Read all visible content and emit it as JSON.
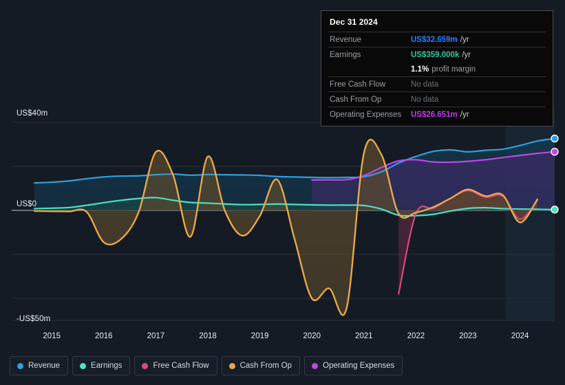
{
  "tooltip": {
    "date": "Dec 31 2024",
    "rows": [
      {
        "key": "Revenue",
        "value": "US$32.659m",
        "unit": "/yr",
        "color": "#2a7fff",
        "nodata": false
      },
      {
        "key": "Earnings",
        "value": "US$359.000k",
        "unit": "/yr",
        "color": "#2fc9a8",
        "nodata": false
      },
      {
        "key": "",
        "value": "1.1%",
        "unit": "profit margin",
        "color": "#ffffff",
        "margin": true
      },
      {
        "key": "Free Cash Flow",
        "value": "No data",
        "unit": "",
        "color": "#6d7075",
        "nodata": true
      },
      {
        "key": "Cash From Op",
        "value": "No data",
        "unit": "",
        "color": "#6d7075",
        "nodata": true
      },
      {
        "key": "Operating Expenses",
        "value": "US$26.651m",
        "unit": "/yr",
        "color": "#c23bf0",
        "nodata": false
      }
    ]
  },
  "legend": {
    "items": [
      {
        "label": "Revenue",
        "color": "#2e9fe0"
      },
      {
        "label": "Earnings",
        "color": "#4ee0c0"
      },
      {
        "label": "Free Cash Flow",
        "color": "#d94a7a"
      },
      {
        "label": "Cash From Op",
        "color": "#e8a84a"
      },
      {
        "label": "Operating Expenses",
        "color": "#bf47e8"
      }
    ]
  },
  "axis": {
    "y_top": "US$40m",
    "y_zero": "US$0",
    "y_bottom": "-US$50m",
    "x_ticks": [
      "2015",
      "2016",
      "2017",
      "2018",
      "2019",
      "2020",
      "2021",
      "2022",
      "2023",
      "2024"
    ]
  },
  "chart_data": {
    "type": "line",
    "title": "",
    "xlabel": "",
    "ylabel": "US$",
    "ylim": [
      -50,
      40
    ],
    "ytick_values": [
      40,
      20,
      0,
      -20,
      -40
    ],
    "ytick_labels": [
      "US$40m",
      "",
      "US$0",
      "",
      "-US$50m"
    ],
    "grid": true,
    "legend_position": "bottom",
    "x": [
      "2014.6",
      "2015",
      "2015.4",
      "2015.8",
      "2016",
      "2016.3",
      "2016.6",
      "2017",
      "2017.3",
      "2017.6",
      "2018",
      "2018.3",
      "2018.6",
      "2019",
      "2019.3",
      "2019.6",
      "2020",
      "2020.3",
      "2020.6",
      "2021",
      "2021.3",
      "2021.6",
      "2022",
      "2022.3",
      "2022.6",
      "2023",
      "2023.3",
      "2023.6",
      "2024",
      "2024.5",
      "2024.95"
    ],
    "series": [
      {
        "name": "Revenue",
        "color": "#2e9fe0",
        "fill": "#143a52",
        "values": [
          12.5,
          12.8,
          13.4,
          14.4,
          15.2,
          15.6,
          15.7,
          16.2,
          16.5,
          16.0,
          16.3,
          16.2,
          16.1,
          15.9,
          15.4,
          15.2,
          15.0,
          14.9,
          15.0,
          15.3,
          17.5,
          21.5,
          24.5,
          26.8,
          27.5,
          26.6,
          27.3,
          27.8,
          29.5,
          31.5,
          32.659
        ]
      },
      {
        "name": "Earnings",
        "color": "#4ee0c0",
        "fill": "#17484a",
        "values": [
          0.8,
          1.0,
          1.3,
          2.3,
          3.5,
          4.6,
          5.4,
          5.8,
          4.6,
          3.6,
          3.3,
          2.9,
          2.6,
          2.7,
          2.9,
          2.7,
          2.5,
          2.4,
          2.4,
          2.2,
          0.6,
          -2.2,
          -2.4,
          -1.8,
          -0.3,
          0.9,
          1.2,
          0.8,
          0.6,
          0.5,
          0.359
        ]
      },
      {
        "name": "Free Cash Flow",
        "color": "#d94a7a",
        "fill": "#5a2840",
        "values": [
          null,
          null,
          null,
          null,
          null,
          null,
          null,
          null,
          null,
          null,
          null,
          null,
          null,
          null,
          null,
          null,
          null,
          null,
          null,
          null,
          null,
          -38.0,
          -1.5,
          1.0,
          5.5,
          9.0,
          6.0,
          6.5,
          -4.0,
          4.5,
          null
        ]
      },
      {
        "name": "Cash From Op",
        "color": "#e8a84a",
        "fill": "#5c4a2c",
        "values": [
          -0.3,
          -0.4,
          -0.5,
          -0.6,
          -14.5,
          -13.0,
          -1.0,
          26.5,
          16.0,
          -12.0,
          24.5,
          -0.5,
          -11.5,
          -2.5,
          14.0,
          -13.0,
          -40.0,
          -35.5,
          -44.5,
          26.0,
          25.5,
          -1.5,
          -1.0,
          1.5,
          5.5,
          9.5,
          6.5,
          7.0,
          -5.5,
          5.0,
          null
        ]
      },
      {
        "name": "Operating Expenses",
        "color": "#bf47e8",
        "fill": "#3b2a66",
        "values": [
          null,
          null,
          null,
          null,
          null,
          null,
          null,
          null,
          null,
          null,
          null,
          null,
          null,
          null,
          null,
          null,
          13.8,
          13.9,
          14.0,
          15.8,
          19.5,
          22.5,
          23.0,
          22.0,
          21.9,
          22.3,
          23.0,
          24.0,
          25.0,
          25.9,
          26.651
        ]
      }
    ],
    "endpoints": [
      {
        "name": "Revenue",
        "color": "#2e9fe0",
        "value": 32.659
      },
      {
        "name": "Operating Expenses",
        "color": "#bf47e8",
        "value": 26.651
      },
      {
        "name": "Earnings",
        "color": "#4ee0c0",
        "value": 0.359
      }
    ]
  }
}
